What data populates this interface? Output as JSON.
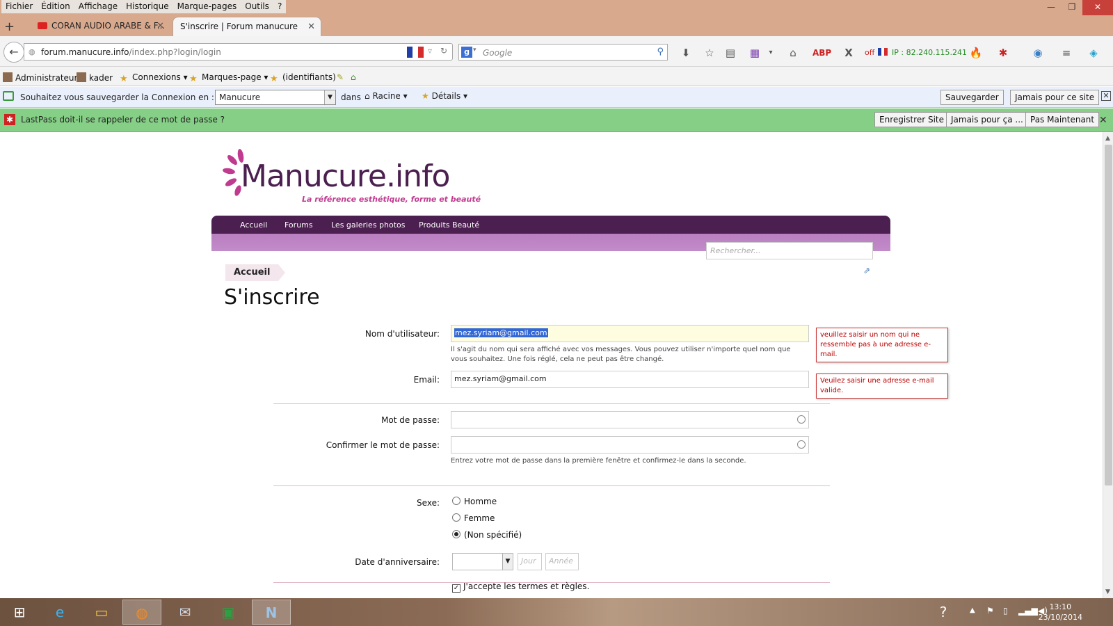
{
  "menu": [
    "Fichier",
    "Édition",
    "Affichage",
    "Historique",
    "Marque-pages",
    "Outils",
    "?"
  ],
  "tabs": [
    {
      "label": "CORAN AUDIO ARABE & F...",
      "active": false
    },
    {
      "label": "S'inscrire | Forum manucure",
      "active": true
    }
  ],
  "nav": {
    "url_host": "forum.manucure.info",
    "url_path": "/index.php?login/login",
    "search_placeholder": "Google",
    "ip_status": "off",
    "ip_text": "IP : 82.240.115.241"
  },
  "bookmarks": [
    "Administrateur",
    "kader",
    "Connexions",
    "Marques-page",
    "(identifiants)"
  ],
  "savebar": {
    "question": "Souhaitez vous sauvegarder la Connexion en :",
    "select_value": "Manucure",
    "in_label": "dans",
    "folder": "Racine",
    "details": "Détails",
    "save": "Sauvegarder",
    "never": "Jamais pour ce site"
  },
  "lastpass": {
    "message": "LastPass doit-il se rappeler de ce mot de passe ?",
    "save_site": "Enregistrer Site",
    "never": "Jamais pour ça ...",
    "not_now": "Pas Maintenant"
  },
  "site": {
    "logo": "Manucure.info",
    "tagline": "La référence esthétique, forme et beauté",
    "nav": [
      "Accueil",
      "Forums",
      "Les galeries photos",
      "Produits Beauté"
    ],
    "search_placeholder": "Rechercher...",
    "breadcrumb": "Accueil"
  },
  "form": {
    "title": "S'inscrire",
    "username_label": "Nom d'utilisateur:",
    "username_value": "mez.syriam@gmail.com",
    "username_help": "Il s'agit du nom qui sera affiché avec vos messages. Vous pouvez utiliser n'importe quel nom que vous souhaitez. Une fois réglé, cela ne peut pas être changé.",
    "username_error": "veuillez saisir un nom qui ne ressemble pas à une adresse e-mail.",
    "email_label": "Email:",
    "email_value": "mez.syriam@gmail.com",
    "email_error": "Veuilez saisir une adresse e-mail valide.",
    "password_label": "Mot de passe:",
    "confirm_label": "Confirmer le mot de passe:",
    "password_help": "Entrez votre mot de passe dans la première fenêtre et confirmez-le dans la seconde.",
    "gender_label": "Sexe:",
    "gender_options": [
      "Homme",
      "Femme",
      "(Non spécifié)"
    ],
    "gender_selected": 2,
    "birthday_label": "Date d'anniversaire:",
    "day_placeholder": "Jour",
    "year_placeholder": "Année",
    "terms": "J'accepte les termes et règles."
  },
  "taskbar": {
    "time": "13:10",
    "date": "23/10/2014"
  },
  "colors": {
    "site_purple": "#4b1f4f",
    "site_pink": "#c03a8f",
    "lastpass_green": "#86cf86",
    "error_red": "#cc3333"
  }
}
